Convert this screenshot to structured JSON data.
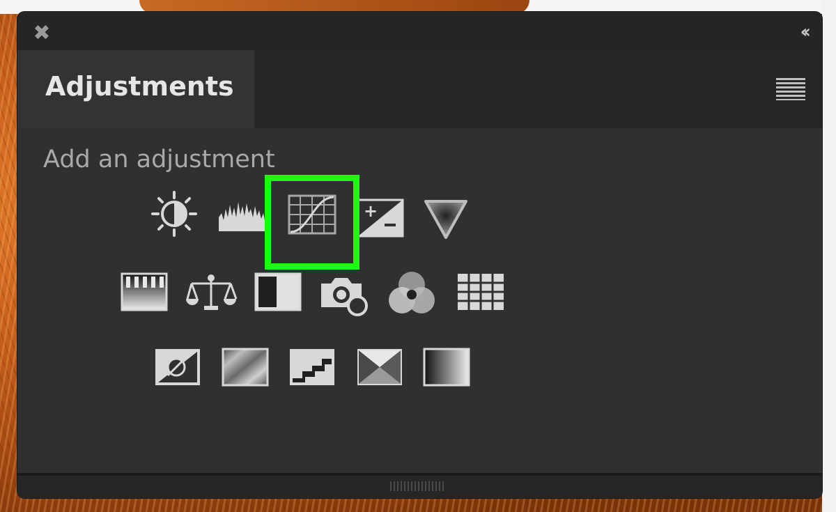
{
  "panel": {
    "tab_title": "Adjustments",
    "subtitle": "Add an adjustment"
  },
  "icons": {
    "row1": [
      "brightness-contrast-icon",
      "levels-icon",
      "curves-icon",
      "exposure-icon",
      "vibrance-icon"
    ],
    "row2": [
      "hue-saturation-icon",
      "color-balance-icon",
      "black-white-icon",
      "photo-filter-icon",
      "channel-mixer-icon",
      "color-lookup-icon"
    ],
    "row3": [
      "invert-icon",
      "posterize-icon",
      "threshold-icon",
      "selective-color-icon",
      "gradient-map-icon"
    ]
  },
  "colors": {
    "panel_bg": "#303030",
    "highlight": "#1aff0f"
  }
}
